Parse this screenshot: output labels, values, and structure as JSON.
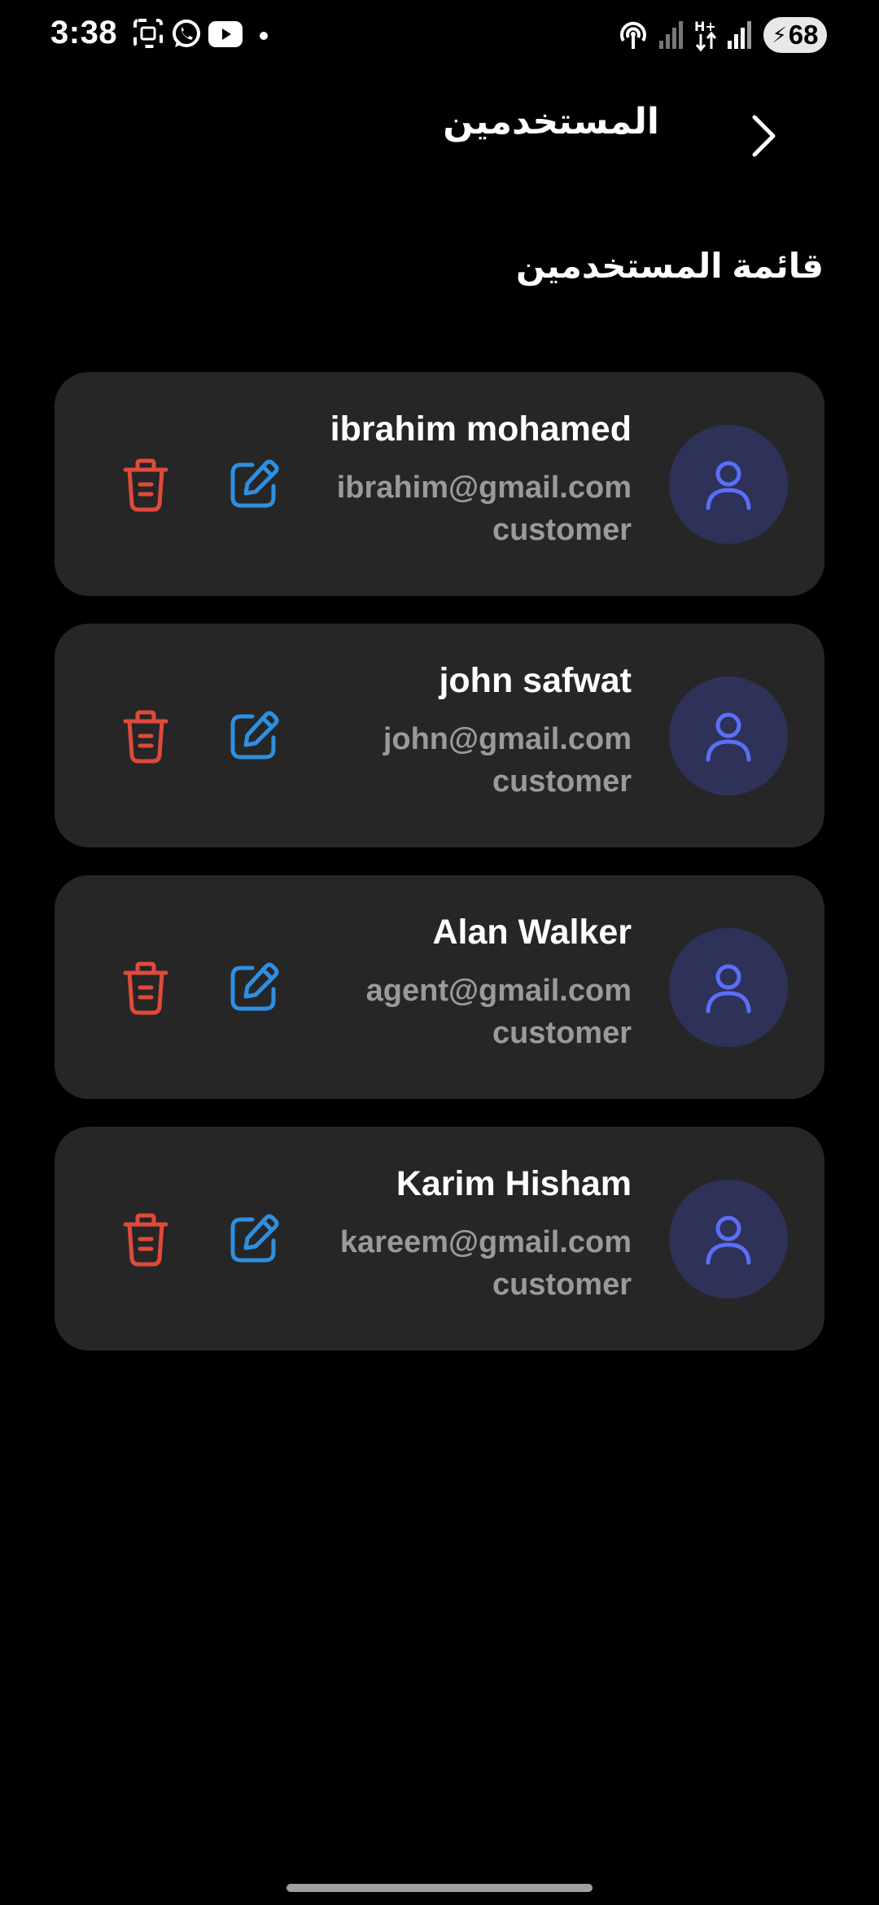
{
  "status_bar": {
    "time": "3:38",
    "battery": "68",
    "left_icons": [
      "screenshot-icon",
      "whatsapp-icon",
      "youtube-icon",
      "dot-icon"
    ],
    "right_icons": [
      "hotspot-icon",
      "signal-weak-icon",
      "data-arrows-icon",
      "signal-icon",
      "battery-icon"
    ]
  },
  "header": {
    "title": "المستخدمين",
    "back_icon": "chevron-right-icon"
  },
  "section": {
    "title": "قائمة المستخدمين"
  },
  "users": [
    {
      "name": "ibrahim mohamed",
      "email": "ibrahim@gmail.com",
      "role": "customer"
    },
    {
      "name": "john safwat",
      "email": "john@gmail.com",
      "role": "customer"
    },
    {
      "name": "Alan Walker",
      "email": "agent@gmail.com",
      "role": "customer"
    },
    {
      "name": "Karim Hisham",
      "email": "kareem@gmail.com",
      "role": "customer"
    }
  ],
  "colors": {
    "background": "#000000",
    "card": "#262626",
    "avatar_bg": "#2e3258",
    "avatar_icon": "#5b6ef5",
    "edit": "#2f8fe0",
    "delete": "#e04a3c",
    "secondary_text": "#9a9a9a"
  }
}
